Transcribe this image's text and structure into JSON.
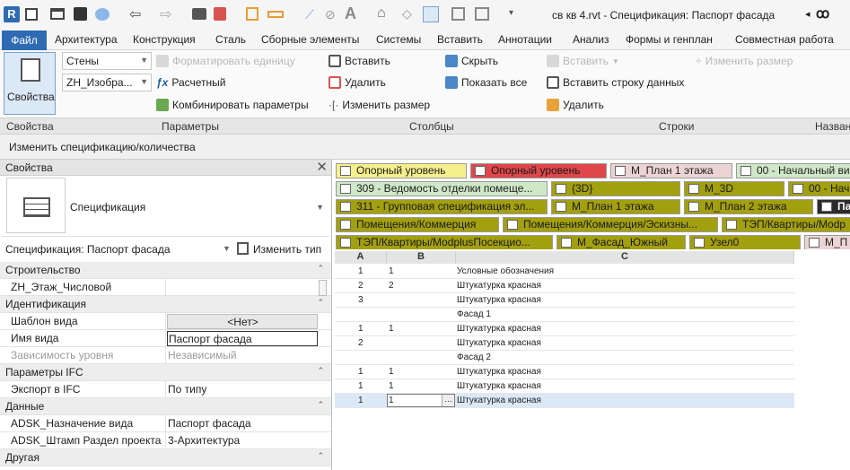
{
  "window": {
    "title": "св кв 4.rvt - Спецификация: Паспорт фасада"
  },
  "ribbon_tabs": [
    "Файл",
    "Архитектура",
    "Конструкция",
    "Сталь",
    "Сборные элементы",
    "Системы",
    "Вставить",
    "Аннотации",
    "Анализ",
    "Формы и генплан",
    "Совместная работа"
  ],
  "ribbon": {
    "properties_button": "Свойства",
    "category_combo": "Стены",
    "view_combo": "ZH_Изобра...",
    "format_unit": "Форматировать единицу",
    "calculated": "Расчетный",
    "combine_params": "Комбинировать параметры",
    "col_insert": "Вставить",
    "col_delete": "Удалить",
    "col_resize": "Изменить размер",
    "hide": "Скрыть",
    "show_all": "Показать все",
    "row_insert": "Вставить",
    "row_insert_data": "Вставить строку данных",
    "row_delete": "Удалить",
    "row_resize": "Изменить размер"
  },
  "panels": [
    "Свойства",
    "Параметры",
    "Столбцы",
    "Строки",
    "Назван"
  ],
  "context_label": "Изменить спецификацию/количества",
  "properties": {
    "title": "Свойства",
    "type_name": "Спецификация",
    "instance": "Спецификация: Паспорт фасада",
    "edit_type": "Изменить тип",
    "rows": [
      {
        "kind": "group",
        "label": "Строительство"
      },
      {
        "kind": "row",
        "label": "ZH_Этаж_Числовой",
        "value": ""
      },
      {
        "kind": "group",
        "label": "Идентификация"
      },
      {
        "kind": "row",
        "label": "Шаблон вида",
        "value": "<Нет>"
      },
      {
        "kind": "row",
        "label": "Имя вида",
        "value": "Паспорт фасада"
      },
      {
        "kind": "row",
        "label": "Зависимость уровня",
        "value": "Независимый"
      },
      {
        "kind": "group",
        "label": "Параметры IFC"
      },
      {
        "kind": "row",
        "label": "Экспорт в IFC",
        "value": "По типу"
      },
      {
        "kind": "group",
        "label": "Данные"
      },
      {
        "kind": "row",
        "label": "ADSK_Назначение вида",
        "value": "Паспорт фасада"
      },
      {
        "kind": "row",
        "label": "ADSK_Штамп Раздел проекта",
        "value": "3-Архитектура"
      },
      {
        "kind": "group",
        "label": "Другая"
      }
    ]
  },
  "view_tabs": [
    [
      "Опорный уровень",
      "Опорный уровень",
      "М_План 1 этажа",
      "00 - Начальный ви"
    ],
    [
      "309 - Ведомость отделки помеще...",
      "{3D}",
      "М_3D",
      "00 - Нача"
    ],
    [
      "311 - Групповая спецификация эл...",
      "М_План 1 этажа",
      "М_План 2 этажа",
      "Пас"
    ],
    [
      "Помещения/Коммерция",
      "Помещения/Коммерция/Эскизны...",
      "ТЭП/Квартиры/Modp"
    ],
    [
      "ТЭП/Квартиры/ModplusПосекцио...",
      "М_Фасад_Южный",
      "Узел0",
      "М_П"
    ]
  ],
  "schedule": {
    "headers": [
      "A",
      "B",
      "C"
    ],
    "rows": [
      [
        "1",
        "1",
        "Условные обозначения"
      ],
      [
        "2",
        "2",
        "Штукатурка красная"
      ],
      [
        "3",
        "",
        "Штукатурка красная"
      ],
      [
        "",
        "",
        "Фасад 1"
      ],
      [
        "1",
        "1",
        "Штукатурка красная"
      ],
      [
        "2",
        "",
        "Штукатурка красная"
      ],
      [
        "",
        "",
        "Фасад 2"
      ],
      [
        "1",
        "1",
        "Штукатурка красная"
      ],
      [
        "1",
        "1",
        "Штукатурка красная"
      ],
      [
        "1",
        "1",
        "Штукатурка красная"
      ]
    ],
    "selected_row": 9
  },
  "colors": {
    "accent": "#2e6bb3",
    "tab_yellow": "#f5f08c",
    "tab_red": "#e0474a",
    "tab_pink": "#ecd4d4",
    "tab_green": "#cfe8c8",
    "tab_olive": "#a3a00f"
  }
}
